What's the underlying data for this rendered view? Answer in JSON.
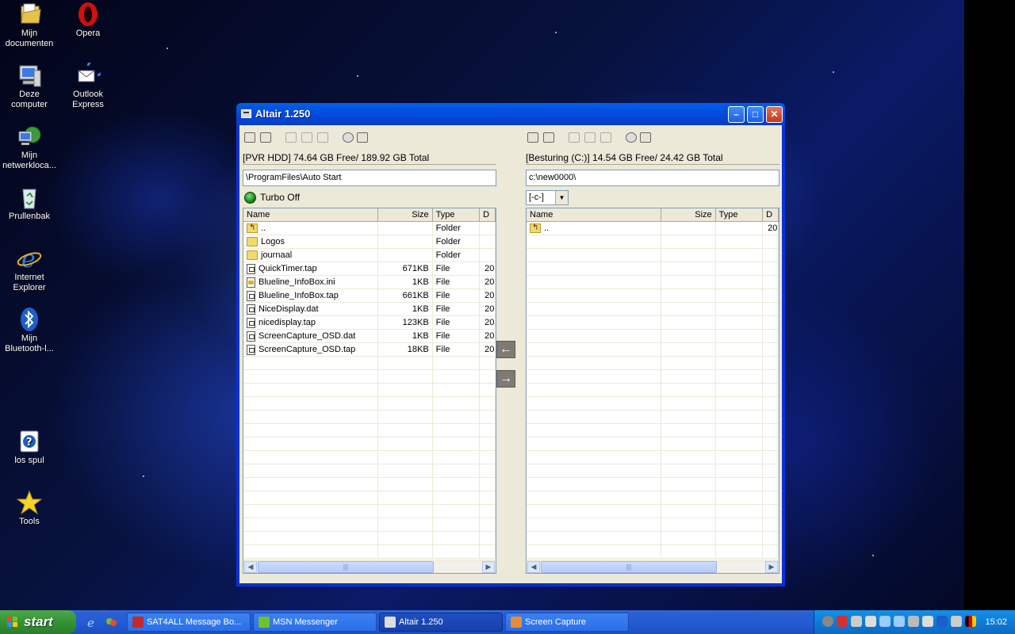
{
  "desktop": {
    "icons": [
      {
        "label": "Mijn documenten"
      },
      {
        "label": "Deze computer"
      },
      {
        "label": "Mijn netwerkloca..."
      },
      {
        "label": "Prullenbak"
      },
      {
        "label": "Internet Explorer"
      },
      {
        "label": "Mijn Bluetooth-l..."
      },
      {
        "label": "los spul"
      },
      {
        "label": "Tools"
      },
      {
        "label": "Opera"
      },
      {
        "label": "Outlook Express"
      }
    ]
  },
  "window": {
    "title": "Altair 1.250",
    "left": {
      "info": "[PVR HDD] 74.64 GB Free/ 189.92 GB Total",
      "path": "\\ProgramFiles\\Auto Start",
      "turbo": "Turbo Off",
      "columns": [
        "Name",
        "Size",
        "Type",
        "D"
      ],
      "rows": [
        {
          "icon": "up-folder-icon",
          "name": "..",
          "size": "",
          "type": "Folder",
          "date": ""
        },
        {
          "icon": "folder-icon",
          "name": "Logos",
          "size": "",
          "type": "Folder",
          "date": ""
        },
        {
          "icon": "folder-icon",
          "name": "journaal",
          "size": "",
          "type": "Folder",
          "date": ""
        },
        {
          "icon": "file-icon",
          "name": "QuickTimer.tap",
          "size": "671KB",
          "type": "File",
          "date": "20"
        },
        {
          "icon": "ini-file-icon",
          "name": "Blueline_InfoBox.ini",
          "size": "1KB",
          "type": "File",
          "date": "20"
        },
        {
          "icon": "file-icon",
          "name": "Blueline_InfoBox.tap",
          "size": "661KB",
          "type": "File",
          "date": "20"
        },
        {
          "icon": "file-icon",
          "name": "NiceDisplay.dat",
          "size": "1KB",
          "type": "File",
          "date": "20"
        },
        {
          "icon": "file-icon",
          "name": "nicedisplay.tap",
          "size": "123KB",
          "type": "File",
          "date": "20"
        },
        {
          "icon": "file-icon",
          "name": "ScreenCapture_OSD.dat",
          "size": "1KB",
          "type": "File",
          "date": "20"
        },
        {
          "icon": "file-icon",
          "name": "ScreenCapture_OSD.tap",
          "size": "18KB",
          "type": "File",
          "date": "20"
        }
      ]
    },
    "right": {
      "info": "[Besturing (C:)] 14.54 GB Free/ 24.42 GB Total",
      "path": "c:\\new0000\\",
      "drive": "[-c-]",
      "columns": [
        "Name",
        "Size",
        "Type",
        "D"
      ],
      "rows": [
        {
          "icon": "up-folder-icon",
          "name": "..",
          "size": "",
          "type": "",
          "date": "20"
        }
      ]
    }
  },
  "taskbar": {
    "start_label": "start",
    "tasks": [
      {
        "label": "SAT4ALL Message Bo...",
        "active": false
      },
      {
        "label": "MSN Messenger",
        "active": false
      },
      {
        "label": "Altair 1.250",
        "active": true
      },
      {
        "label": "Screen Capture",
        "active": false
      }
    ],
    "clock": "15:02"
  }
}
